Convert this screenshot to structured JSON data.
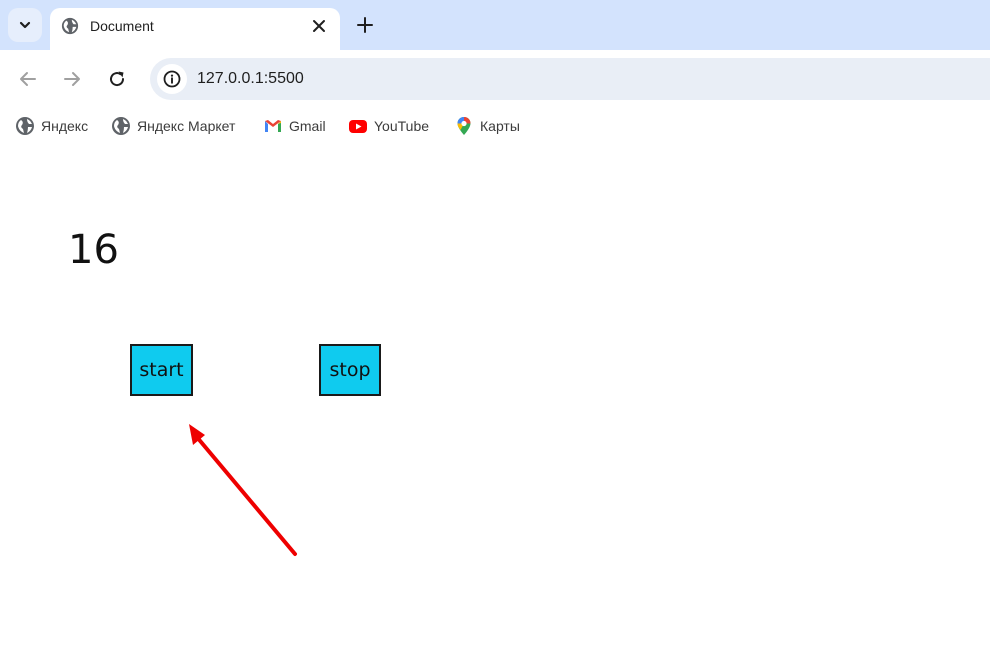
{
  "tab": {
    "title": "Document"
  },
  "address_bar": {
    "url": "127.0.0.1:5500"
  },
  "bookmarks": [
    {
      "label": "Яндекс",
      "icon": "globe-icon"
    },
    {
      "label": "Яндекс Маркет",
      "icon": "globe-icon"
    },
    {
      "label": "Gmail",
      "icon": "gmail-icon"
    },
    {
      "label": "YouTube",
      "icon": "youtube-icon"
    },
    {
      "label": "Карты",
      "icon": "maps-pin-icon"
    }
  ],
  "page": {
    "counter": "16",
    "start_label": "start",
    "stop_label": "stop"
  },
  "colors": {
    "tabstrip": "#d3e3fd",
    "button": "#0fcbef",
    "annotation_arrow": "#ee0000"
  }
}
